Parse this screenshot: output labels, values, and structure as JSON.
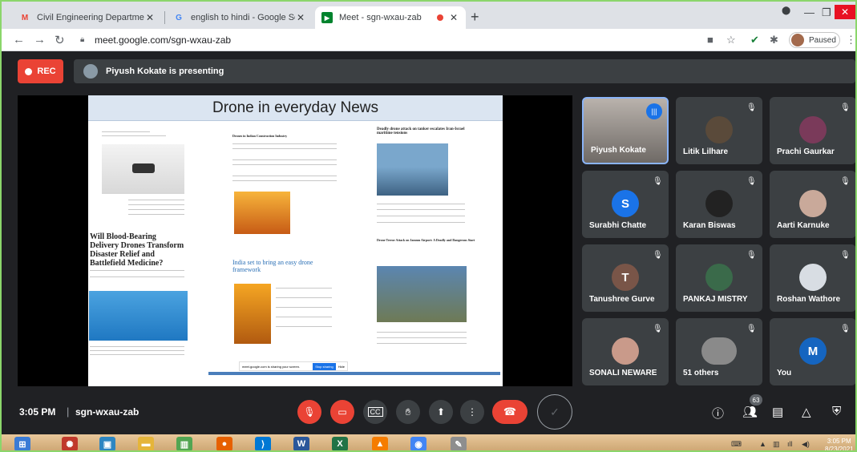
{
  "browser": {
    "tabs": [
      {
        "title": "Civil Engineering Department or",
        "favicon": "gmail-icon"
      },
      {
        "title": "english to hindi - Google Search",
        "favicon": "google-icon"
      },
      {
        "title": "Meet - sgn-wxau-zab",
        "favicon": "meet-icon"
      }
    ],
    "url": "meet.google.com/sgn-wxau-zab",
    "profile_status": "Paused"
  },
  "meet": {
    "rec_label": "REC",
    "presenting_text": "Piyush Kokate is presenting",
    "time": "3:05 PM",
    "meeting_code": "sgn-wxau-zab",
    "people_count": "63"
  },
  "slide": {
    "title": "Drone in everyday News",
    "headline_left": "Will Blood-Bearing Delivery Drones Transform Disaster Relief and Battlefield Medicine?",
    "headline_mid": "India set to bring an easy drone framework",
    "headline_mid_top": "Drones in Indian Construction Industry",
    "headline_right": "Deadly drone attack on tanker escalates Iran-Israel maritime tensions",
    "headline_right2": "Drone Terror Attack on Jammu Airport: A Deadly and Dangerous Start",
    "share_bar_text": "meet.google.com is sharing your screen.",
    "share_stop": "Stop sharing",
    "share_hide": "Hide"
  },
  "participants": [
    {
      "name": "Piyush Kokate",
      "type": "video",
      "speaking": true
    },
    {
      "name": "Litik Lilhare",
      "type": "photo",
      "color": "#5a4a3a"
    },
    {
      "name": "Prachi Gaurkar",
      "type": "photo",
      "color": "#7a3a5a"
    },
    {
      "name": "Surabhi Chatte",
      "type": "initial",
      "initial": "S",
      "color": "#1a73e8"
    },
    {
      "name": "Karan Biswas",
      "type": "photo",
      "color": "#222222"
    },
    {
      "name": "Aarti Karnuke",
      "type": "photo",
      "color": "#c9a99a"
    },
    {
      "name": "Tanushree Gurve",
      "type": "initial",
      "initial": "T",
      "color": "#795548"
    },
    {
      "name": "PANKAJ MISTRY",
      "type": "photo",
      "color": "#3a6a4a"
    },
    {
      "name": "Roshan Wathore",
      "type": "photo",
      "color": "#d8dde3"
    },
    {
      "name": "SONALI NEWARE",
      "type": "photo",
      "color": "#c99a8a"
    },
    {
      "name": "51 others",
      "type": "group",
      "color": "#8a8a8a"
    },
    {
      "name": "You",
      "type": "initial",
      "initial": "M",
      "color": "#1565c0"
    }
  ],
  "taskbar": {
    "time": "3:05 PM",
    "date": "8/23/2021"
  }
}
